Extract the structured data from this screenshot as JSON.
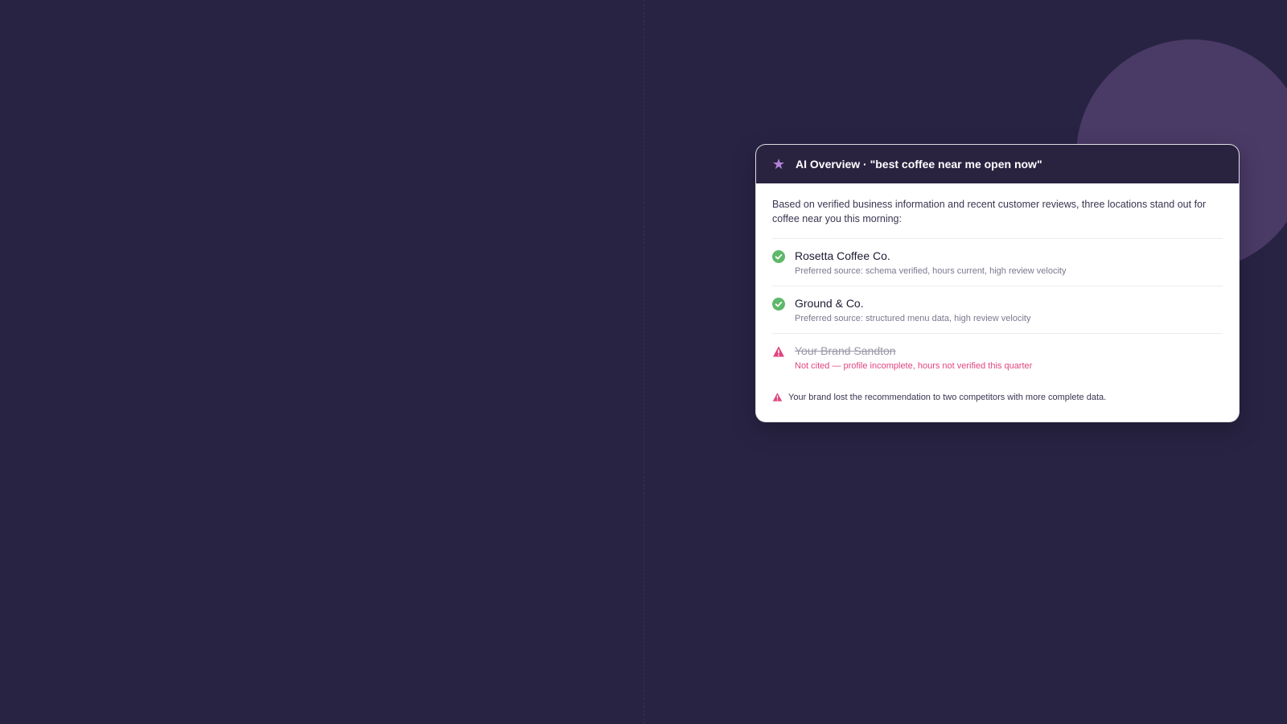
{
  "overview": {
    "title": "AI Overview · \"best coffee near me open now\"",
    "star_icon": "★",
    "intro": "Based on verified business information and recent customer reviews, three locations stand out for coffee near you this morning:",
    "results": [
      {
        "name": "Rosetta Coffee Co.",
        "detail": "Preferred source: schema verified, hours current, high review velocity",
        "status": "cited",
        "icon": "check-circle-icon"
      },
      {
        "name": "Ground & Co.",
        "detail": "Preferred source: structured menu data, high review velocity",
        "status": "cited",
        "icon": "check-circle-icon"
      },
      {
        "name": "Your Brand Sandton",
        "detail": "Not cited — profile incomplete, hours not verified this quarter",
        "status": "not-cited",
        "icon": "warning-triangle-icon"
      }
    ],
    "footer_note": "Your brand lost the recommendation to two competitors with more complete data."
  },
  "colors": {
    "background": "#282343",
    "header": "#2a2340",
    "accent_star": "#b383d8",
    "success": "#5fb86a",
    "warning": "#e0457f",
    "decorative_circle": "#4a3a66"
  }
}
